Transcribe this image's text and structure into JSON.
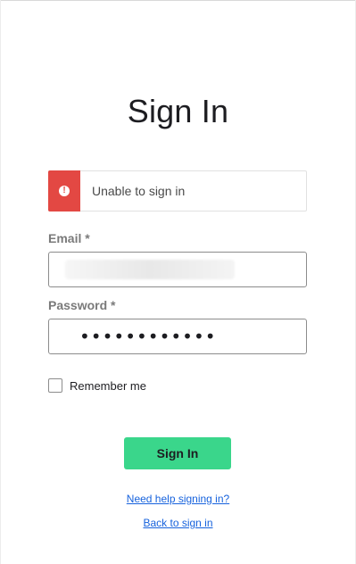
{
  "page": {
    "title": "Sign In"
  },
  "alert": {
    "icon": "exclamation-circle-icon",
    "icon_glyph": "!",
    "message": "Unable to sign in",
    "color": "#e34843"
  },
  "form": {
    "email_label": "Email *",
    "email_value": "",
    "password_label": "Password *",
    "password_value": "••••••••••••",
    "remember_label": "Remember me",
    "remember_checked": false,
    "submit_label": "Sign In",
    "submit_color": "#3ad68b"
  },
  "links": {
    "help": "Need help signing in?",
    "back": "Back to sign in",
    "color": "#1662dd"
  }
}
